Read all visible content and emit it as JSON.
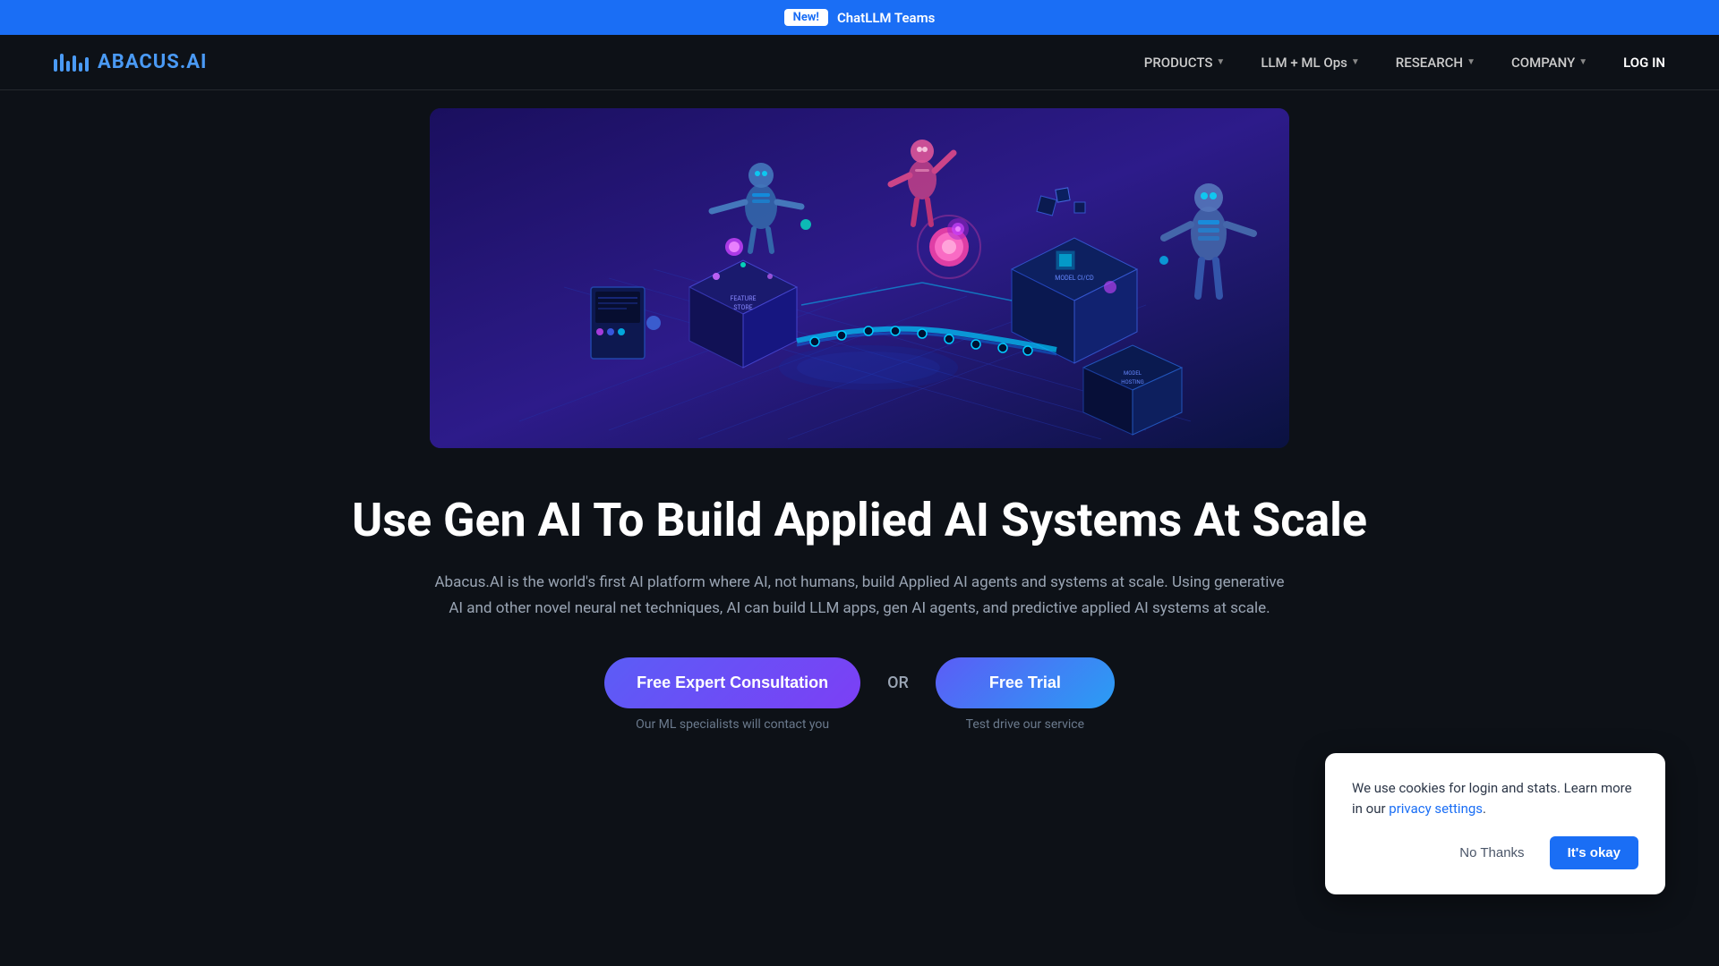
{
  "announcement": {
    "new_label": "New!",
    "link_text": "ChatLLM Teams"
  },
  "navbar": {
    "logo_text": "ABACUS",
    "logo_suffix": ".AI",
    "products_label": "PRODUCTS",
    "llm_ops_label": "LLM + ML Ops",
    "research_label": "RESEARCH",
    "company_label": "COMPANY",
    "login_label": "LOG IN"
  },
  "hero": {
    "title": "Use Gen AI To Build Applied AI Systems At Scale",
    "description": "Abacus.AI is the world's first AI platform where AI, not humans, build Applied AI agents and systems at scale. Using generative AI and other novel neural net techniques, AI can build LLM apps, gen AI agents, and predictive applied AI systems at scale."
  },
  "cta": {
    "consultation_label": "Free Expert Consultation",
    "consultation_subtext": "Our ML specialists will contact you",
    "or_label": "OR",
    "trial_label": "Free Trial",
    "trial_subtext": "Test drive our service"
  },
  "cookie": {
    "text": "We use cookies for login and stats. Learn more in our ",
    "link_text": "privacy settings",
    "link_suffix": ".",
    "no_thanks_label": "No Thanks",
    "okay_label": "It's okay"
  }
}
